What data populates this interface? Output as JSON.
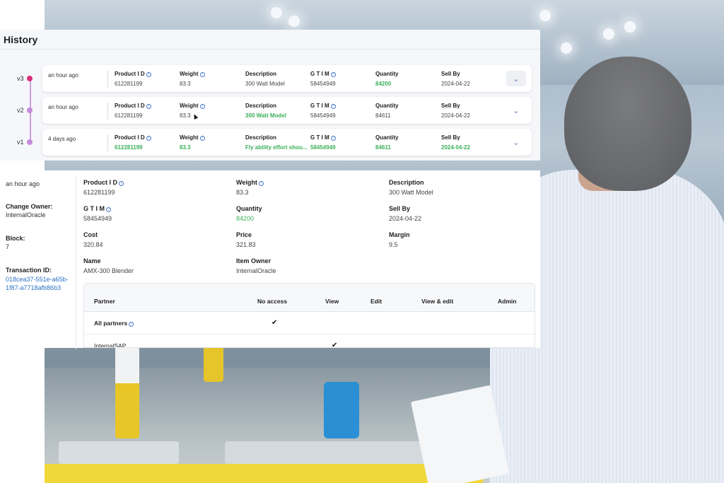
{
  "history": {
    "title": "History",
    "columns": [
      "Product I D",
      "Weight",
      "Description",
      "G T I M",
      "Quantity",
      "Sell By"
    ],
    "versions": [
      {
        "label": "v3",
        "age": "an hour ago",
        "product_id": "612281199",
        "weight": "83.3",
        "description": "300 Watt Model",
        "gtim": "58454949",
        "quantity": "84200",
        "sell_by": "2024-04-22"
      },
      {
        "label": "v2",
        "age": "an hour ago",
        "product_id": "612281199",
        "weight": "83.3",
        "description": "300 Watt Model",
        "gtim": "58454949",
        "quantity": "84611",
        "sell_by": "2024-04-22"
      },
      {
        "label": "v1",
        "age": "4 days ago",
        "product_id": "612281199",
        "weight": "83.3",
        "description": "Fly ability effort shou...",
        "gtim": "58454949",
        "quantity": "84611",
        "sell_by": "2024-04-22"
      }
    ]
  },
  "detail": {
    "age": "an hour ago",
    "change_owner_label": "Change Owner:",
    "change_owner": "InternalOracle",
    "block_label": "Block:",
    "block": "7",
    "transaction_label": "Transaction ID:",
    "transaction_id_line1": "018cea37-551e-a65b-",
    "transaction_id_line2": "1f87-a7718afb86b3",
    "fields": {
      "product_id_label": "Product I D",
      "product_id": "612281199",
      "weight_label": "Weight",
      "weight": "83.3",
      "description_label": "Description",
      "description": "300 Watt Model",
      "gtim_label": "G T I M",
      "gtim": "58454949",
      "quantity_label": "Quantity",
      "quantity": "84200",
      "sell_by_label": "Sell By",
      "sell_by": "2024-04-22",
      "cost_label": "Cost",
      "cost": "320.84",
      "price_label": "Price",
      "price": "321.83",
      "margin_label": "Margin",
      "margin": "9.5",
      "name_label": "Name",
      "name": "AMX-300 Blender",
      "item_owner_label": "Item Owner",
      "item_owner": "InternalOracle"
    },
    "permissions": {
      "headers": {
        "partner": "Partner",
        "no_access": "No access",
        "view": "View",
        "edit": "Edit",
        "view_edit": "View & edit",
        "admin": "Admin"
      },
      "rows": [
        {
          "partner": "All partners",
          "checked": "no_access",
          "mark": "✔"
        },
        {
          "partner": "InternalSAP",
          "checked": "view",
          "mark": "✔"
        }
      ]
    }
  },
  "colors": {
    "changed": "#3bb05a",
    "current_dot": "#d8317a",
    "version_dot": "#c58bdb",
    "link": "#2d72c4"
  }
}
